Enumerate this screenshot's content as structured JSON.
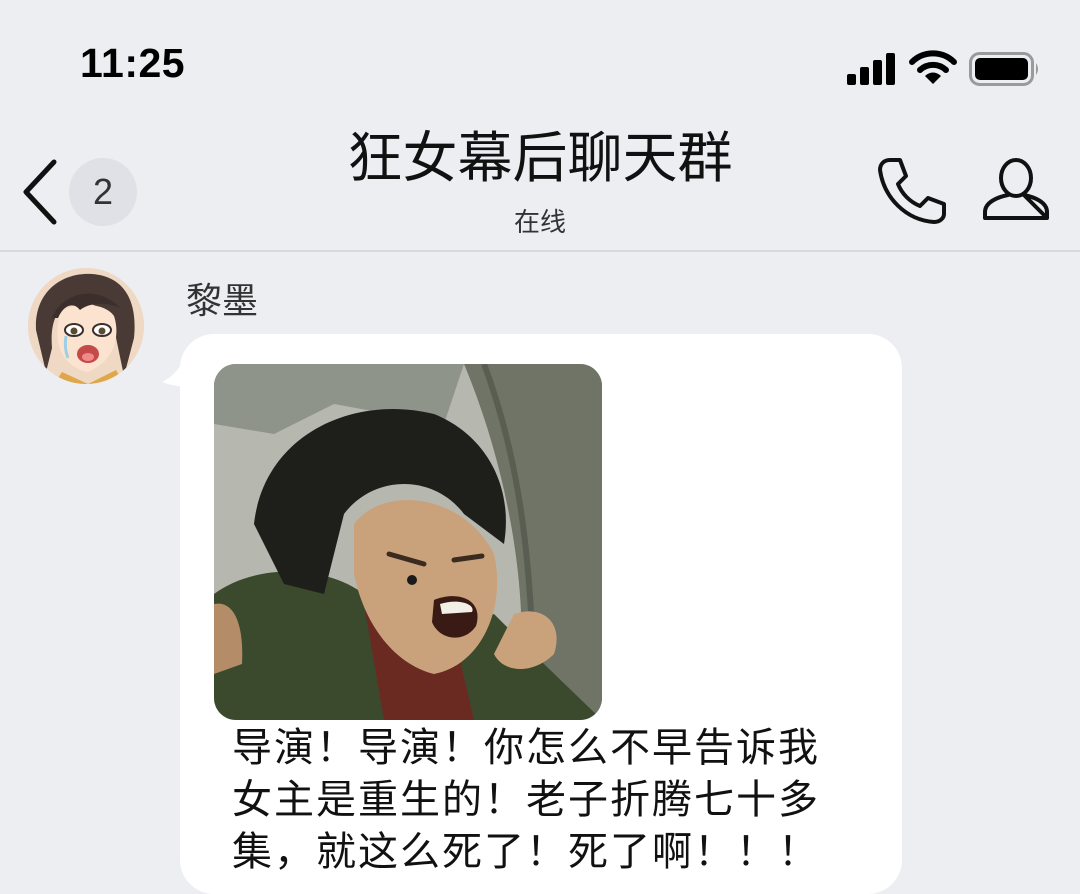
{
  "status_bar": {
    "time": "11:25",
    "icons": [
      "cellular-signal-icon",
      "wifi-icon",
      "battery-icon"
    ]
  },
  "header": {
    "back_icon": "chevron-left-icon",
    "unread_count": "2",
    "title": "狂女幕后聊天群",
    "subtitle": "在线",
    "call_icon": "phone-icon",
    "profile_icon": "person-icon"
  },
  "message": {
    "sender": "黎墨",
    "avatar_icon": "anime-avatar",
    "sticker_icon": "reaction-sticker-image",
    "text": "导演！导演！你怎么不早告诉我\n女主是重生的！老子折腾七十多\n集，就这么死了！死了啊！！！"
  },
  "colors": {
    "background": "#edeef2",
    "bubble": "#ffffff",
    "badge": "#dfe1e7",
    "divider": "#d8d9de"
  }
}
